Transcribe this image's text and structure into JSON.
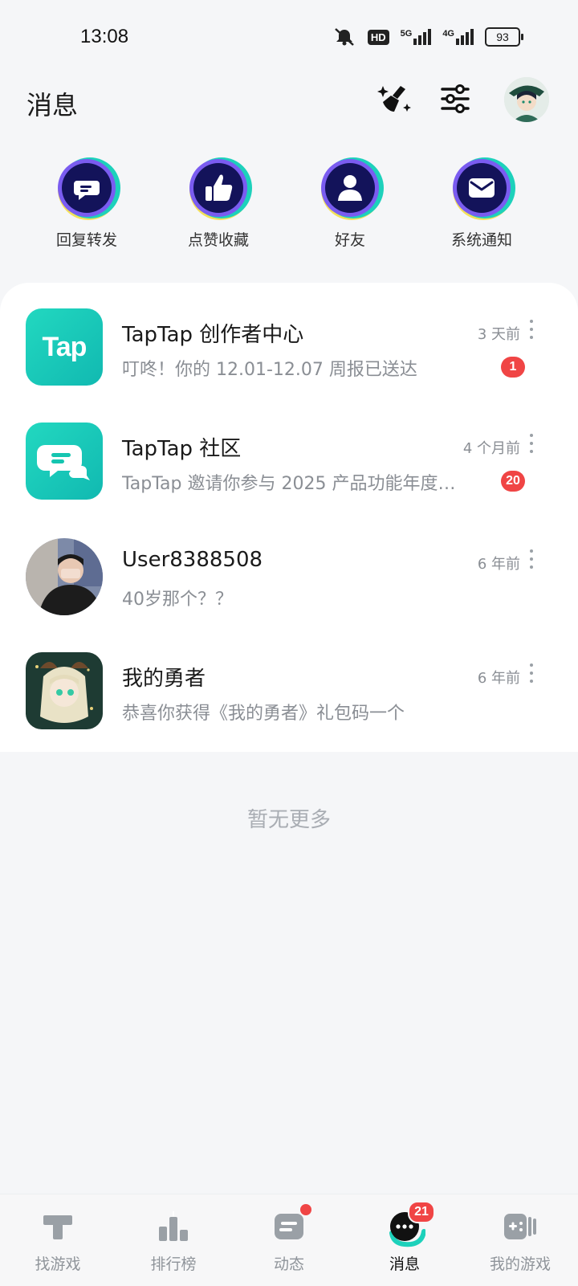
{
  "status_bar": {
    "time": "13:08",
    "network_hd": "HD",
    "network_5g": "5G",
    "network_4g": "4G",
    "battery": "93"
  },
  "header": {
    "title": "消息",
    "icons": [
      "clear-icon",
      "filter-icon",
      "avatar"
    ]
  },
  "quick_actions": [
    {
      "label": "回复转发",
      "icon": "reply-icon"
    },
    {
      "label": "点赞收藏",
      "icon": "thumbs-up-icon"
    },
    {
      "label": "好友",
      "icon": "friend-icon"
    },
    {
      "label": "系统通知",
      "icon": "mail-icon"
    }
  ],
  "messages": [
    {
      "name": "TapTap 创作者中心",
      "preview": "叮咚！你的 12.01-12.07 周报已送达",
      "time": "3 天前",
      "badge": "1",
      "avatar_text": "Tap"
    },
    {
      "name": "TapTap 社区",
      "preview": "TapTap 邀请你参与 2025 产品功能年度…",
      "time": "4 个月前",
      "badge": "20"
    },
    {
      "name": "User8388508",
      "preview": "40岁那个？？",
      "time": "6 年前",
      "badge": ""
    },
    {
      "name": "我的勇者",
      "preview": "恭喜你获得《我的勇者》礼包码一个",
      "time": "6 年前",
      "badge": ""
    }
  ],
  "footer_text": "暂无更多",
  "bottom_nav": [
    {
      "label": "找游戏"
    },
    {
      "label": "排行榜"
    },
    {
      "label": "动态"
    },
    {
      "label": "消息",
      "badge": "21"
    },
    {
      "label": "我的游戏"
    }
  ],
  "colors": {
    "brand_teal": "#15c5b0",
    "badge_red": "#f04545",
    "icon_navy": "#13135a"
  }
}
